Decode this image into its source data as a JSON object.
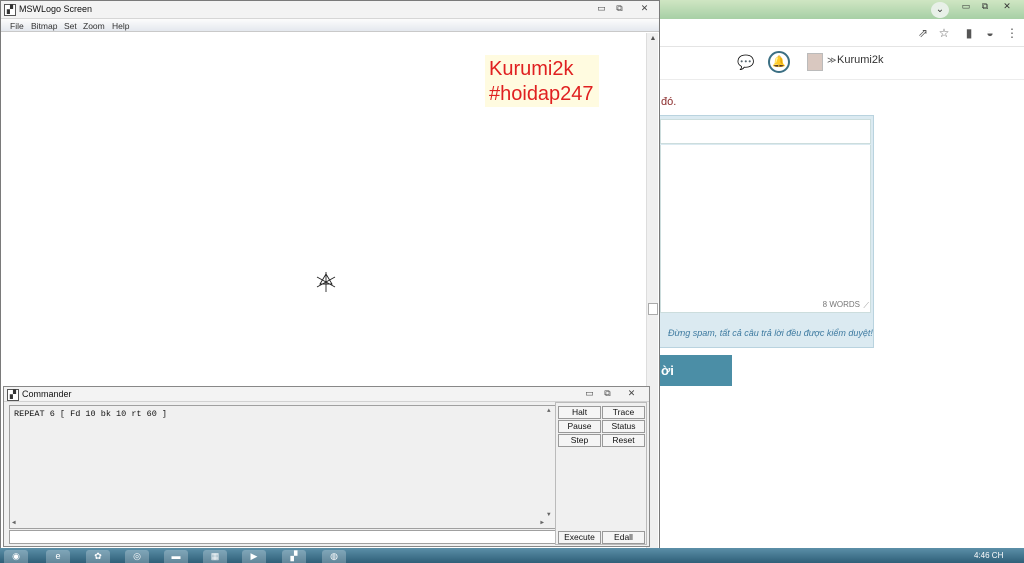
{
  "browser": {
    "site_username": "Kurumi2k",
    "partial_text": "đó.",
    "word_count": "8 WORDS",
    "spam_note": "Đừng spam, tất cả câu trả lời đều được kiểm duyệt!",
    "submit_label": "ời"
  },
  "logo_window": {
    "title": "MSWLogo Screen",
    "menu": [
      "File",
      "Bitmap",
      "Set",
      "Zoom",
      "Help"
    ],
    "watermark": [
      "Kurumi2k",
      "#hoidap247"
    ]
  },
  "commander": {
    "title": "Commander",
    "history": "REPEAT 6 [ Fd 10 bk 10 rt 60 ]",
    "buttons": {
      "halt": "Halt",
      "trace": "Trace",
      "pause": "Pause",
      "status": "Status",
      "step": "Step",
      "reset": "Reset",
      "execute": "Execute",
      "edall": "Edall"
    }
  },
  "taskbar": {
    "clock": "4:46 CH"
  }
}
